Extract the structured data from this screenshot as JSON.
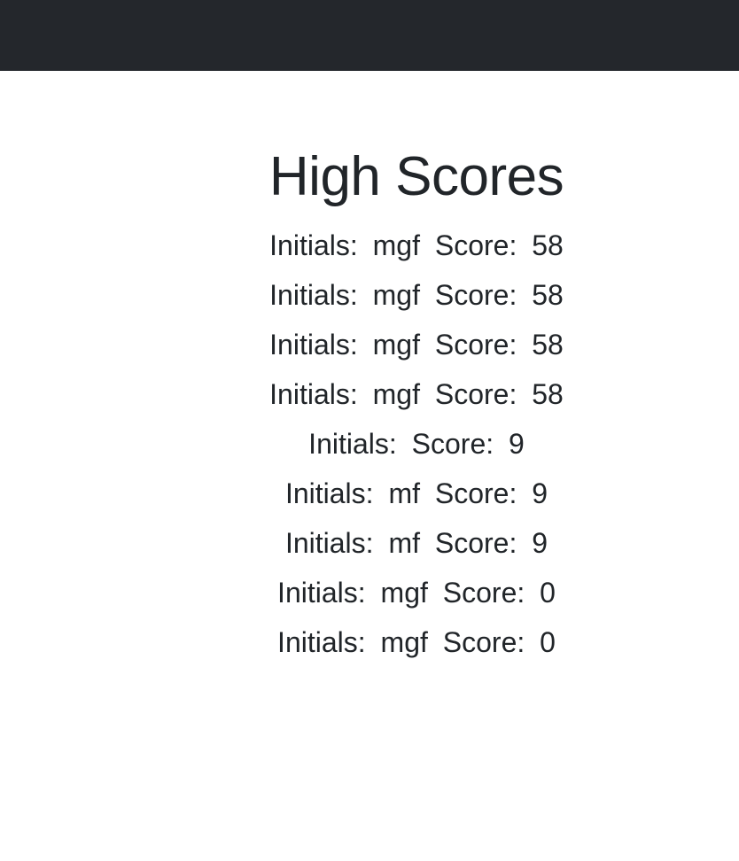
{
  "page": {
    "title": "High Scores"
  },
  "scores": [
    {
      "initials_label": "Initials:",
      "initials": "mgf",
      "score_label": "Score:",
      "score": "58"
    },
    {
      "initials_label": "Initials:",
      "initials": "mgf",
      "score_label": "Score:",
      "score": "58"
    },
    {
      "initials_label": "Initials:",
      "initials": "mgf",
      "score_label": "Score:",
      "score": "58"
    },
    {
      "initials_label": "Initials:",
      "initials": "mgf",
      "score_label": "Score:",
      "score": "58"
    },
    {
      "initials_label": "Initials:",
      "initials": "",
      "score_label": "Score:",
      "score": "9"
    },
    {
      "initials_label": "Initials:",
      "initials": "mf",
      "score_label": "Score:",
      "score": "9"
    },
    {
      "initials_label": "Initials:",
      "initials": "mf",
      "score_label": "Score:",
      "score": "9"
    },
    {
      "initials_label": "Initials:",
      "initials": "mgf",
      "score_label": "Score:",
      "score": "0"
    },
    {
      "initials_label": "Initials:",
      "initials": "mgf",
      "score_label": "Score:",
      "score": "0"
    }
  ]
}
